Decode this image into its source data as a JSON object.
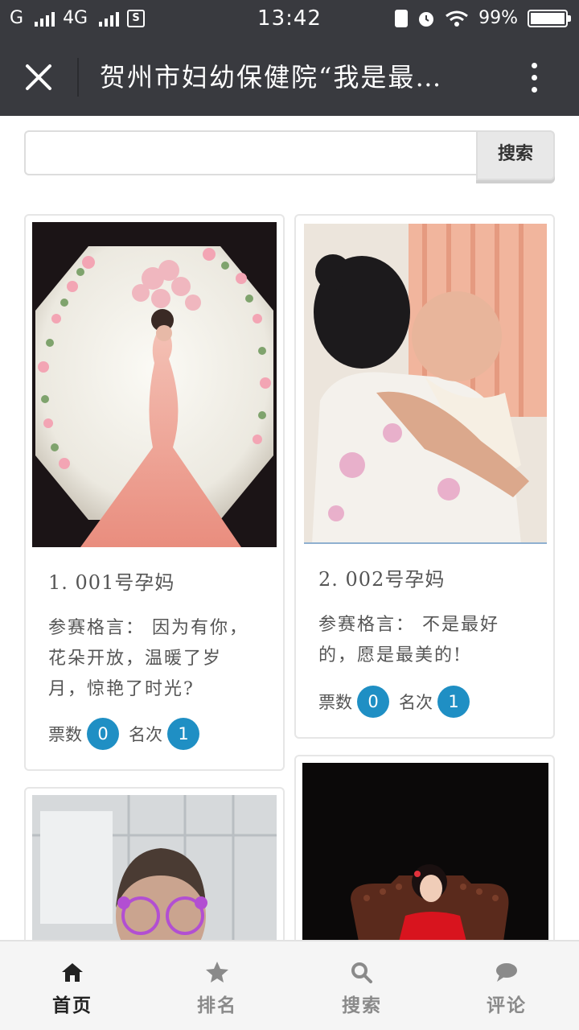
{
  "status_bar": {
    "carrier_1": "G",
    "carrier_2": "4G",
    "sim_label": "S",
    "time": "13:42",
    "battery_percent": "99%",
    "battery_level": 0.99
  },
  "header": {
    "title": "贺州市妇幼保健院“我是最…"
  },
  "search": {
    "placeholder": "",
    "button_label": "搜索"
  },
  "entries": [
    {
      "title": "1. 001号孕妈",
      "motto": "参赛格言： 因为有你，花朵开放，温暖了岁月，惊艳了时光?",
      "votes_label": "票数",
      "votes": "0",
      "rank_label": "名次",
      "rank": "1"
    },
    {
      "title": "2. 002号孕妈",
      "motto": "参赛格言： 不是最好的，愿是最美的!",
      "votes_label": "票数",
      "votes": "0",
      "rank_label": "名次",
      "rank": "1"
    }
  ],
  "bottom_nav": [
    {
      "label": "首页",
      "icon": "home-icon",
      "active": true
    },
    {
      "label": "排名",
      "icon": "star-icon",
      "active": false
    },
    {
      "label": "搜索",
      "icon": "search-icon",
      "active": false
    },
    {
      "label": "评论",
      "icon": "comment-icon",
      "active": false
    }
  ],
  "colors": {
    "header_bg": "#393a3f",
    "badge": "#1f8fc4",
    "nav_active": "#222222",
    "nav_inactive": "#8a8a8a"
  }
}
